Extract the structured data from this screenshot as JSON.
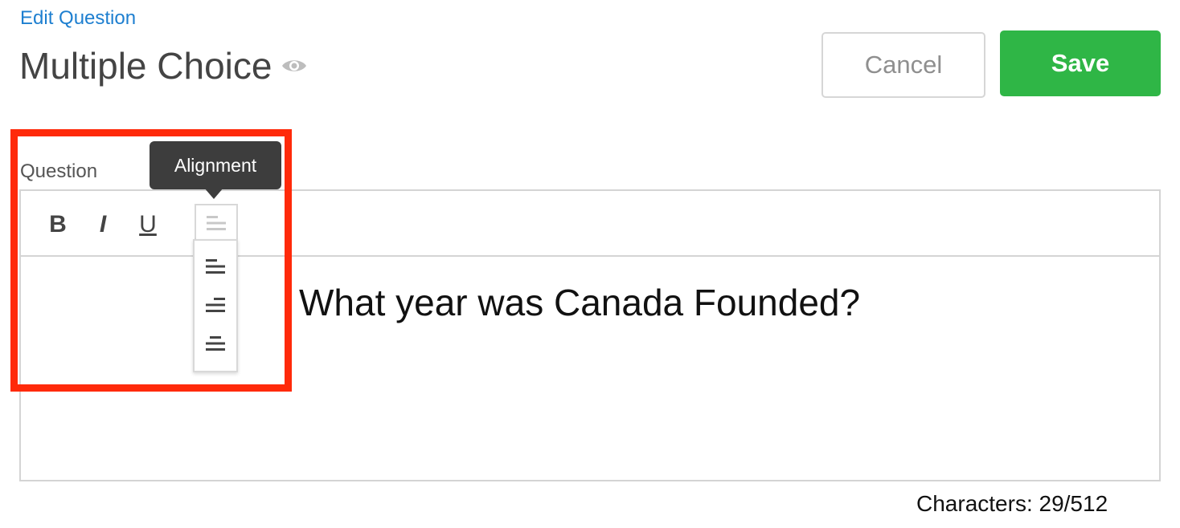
{
  "breadcrumb": "Edit Question",
  "title": "Multiple Choice",
  "header": {
    "cancel_label": "Cancel",
    "save_label": "Save"
  },
  "question": {
    "label": "Question",
    "text": "What year was Canada Founded?"
  },
  "toolbar": {
    "bold_label": "B",
    "italic_label": "I",
    "underline_label": "U",
    "alignment_tooltip": "Alignment"
  },
  "alignment_options": [
    "align-left-icon",
    "align-right-icon",
    "align-center-icon"
  ],
  "character_count": "Characters: 29/512",
  "colors": {
    "link": "#1e7fd0",
    "save": "#2fb646",
    "highlight": "#ff2a0a",
    "tooltip": "#3d3d3d"
  }
}
